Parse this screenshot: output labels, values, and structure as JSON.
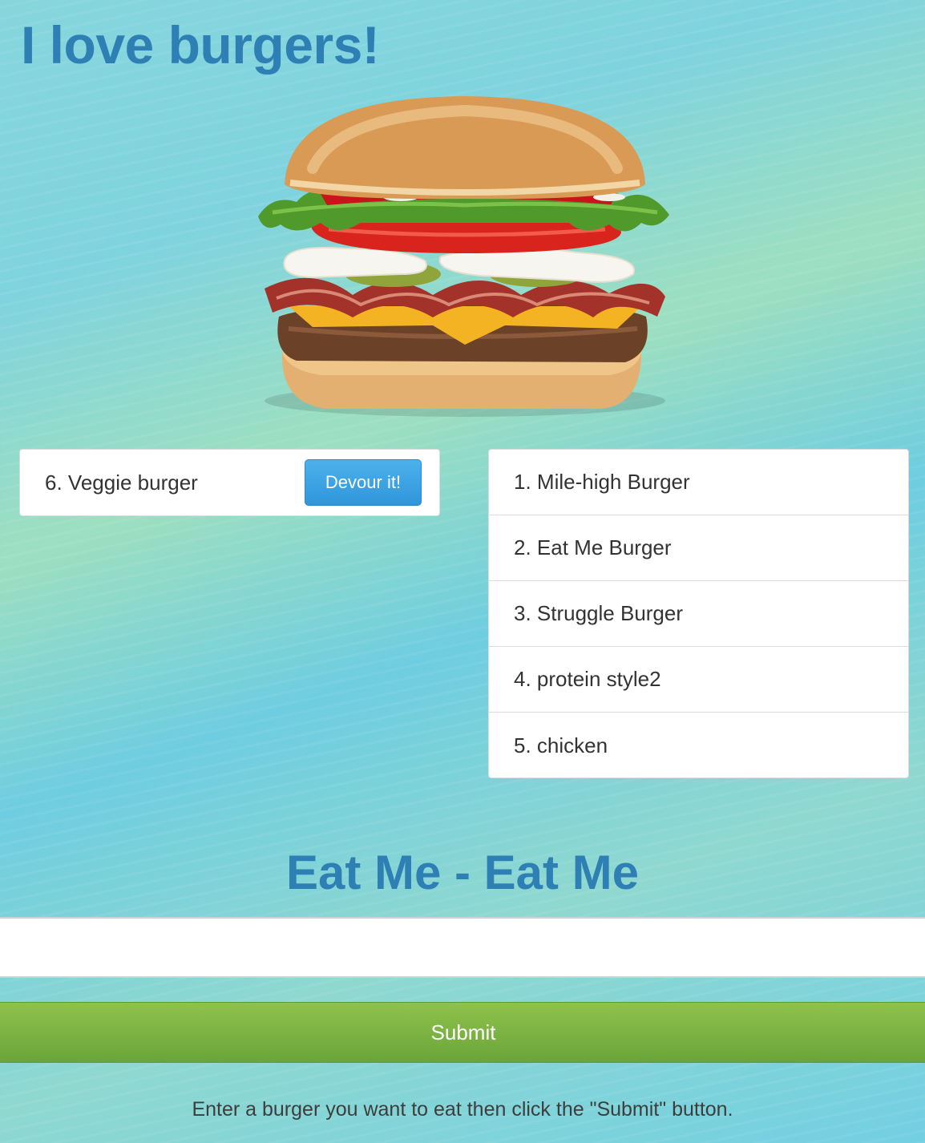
{
  "header": {
    "title": "I love burgers!"
  },
  "hero": {
    "image": "burger-image"
  },
  "uneaten": {
    "items": [
      {
        "label": "6. Veggie burger",
        "button_label": "Devour it!"
      }
    ]
  },
  "devoured": {
    "items": [
      {
        "label": "1. Mile-high Burger"
      },
      {
        "label": "2. Eat Me Burger"
      },
      {
        "label": "3. Struggle Burger"
      },
      {
        "label": "4. protein style2"
      },
      {
        "label": "5. chicken"
      }
    ]
  },
  "form": {
    "heading": "Eat Me - Eat Me",
    "input_value": "",
    "input_placeholder": "",
    "submit_label": "Submit",
    "hint": "Enter a burger you want to eat then click the \"Submit\" button."
  },
  "colors": {
    "title": "#2e80b4",
    "devour_button": "#3aa2e4",
    "submit_button": "#7db444"
  }
}
